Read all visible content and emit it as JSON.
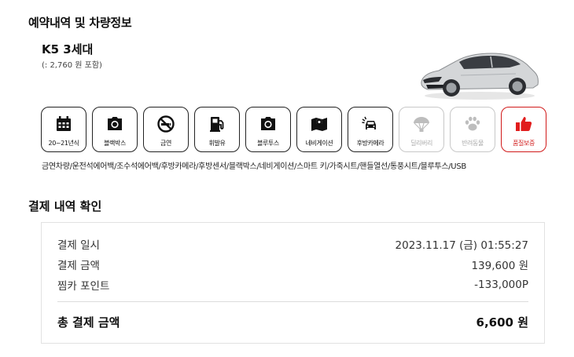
{
  "reservation": {
    "title": "예약내역 및 차량정보",
    "car_name": "K5 3세대",
    "car_sub": "(: 2,760 원 포함)"
  },
  "features": [
    {
      "label": "20~21년식",
      "icon": "calendar-icon",
      "state": "active"
    },
    {
      "label": "블랙박스",
      "icon": "camera-icon",
      "state": "active"
    },
    {
      "label": "금연",
      "icon": "no-smoking-icon",
      "state": "active"
    },
    {
      "label": "휘발유",
      "icon": "fuel-pump-icon",
      "state": "active"
    },
    {
      "label": "블루투스",
      "icon": "camera-icon",
      "state": "active"
    },
    {
      "label": "네비게이션",
      "icon": "map-icon",
      "state": "active"
    },
    {
      "label": "후방카메라",
      "icon": "rear-camera-car-icon",
      "state": "active"
    },
    {
      "label": "딜리버리",
      "icon": "parachute-icon",
      "state": "disabled"
    },
    {
      "label": "반려동물",
      "icon": "paw-icon",
      "state": "disabled"
    },
    {
      "label": "품질보증",
      "icon": "thumbs-up-icon",
      "state": "highlight"
    }
  ],
  "options_text": "금연차량/운전석에어백/조수석에어백/후방카메라/후방센서/블랙박스/네비게이션/스마트 키/가죽시트/핸들열선/통풍시트/블루투스/USB",
  "payment": {
    "title": "결제 내역 확인",
    "rows": [
      {
        "label": "결제 일시",
        "value": "2023.11.17 (금) 01:55:27"
      },
      {
        "label": "결제 금액",
        "value": "139,600 원"
      },
      {
        "label": "찜카 포인트",
        "value": "-133,000P"
      }
    ],
    "total_label": "총 결제 금액",
    "total_value": "6,600 원"
  },
  "colors": {
    "highlight": "#d11a1a",
    "disabled": "#c8c8c8",
    "border": "#222222"
  }
}
